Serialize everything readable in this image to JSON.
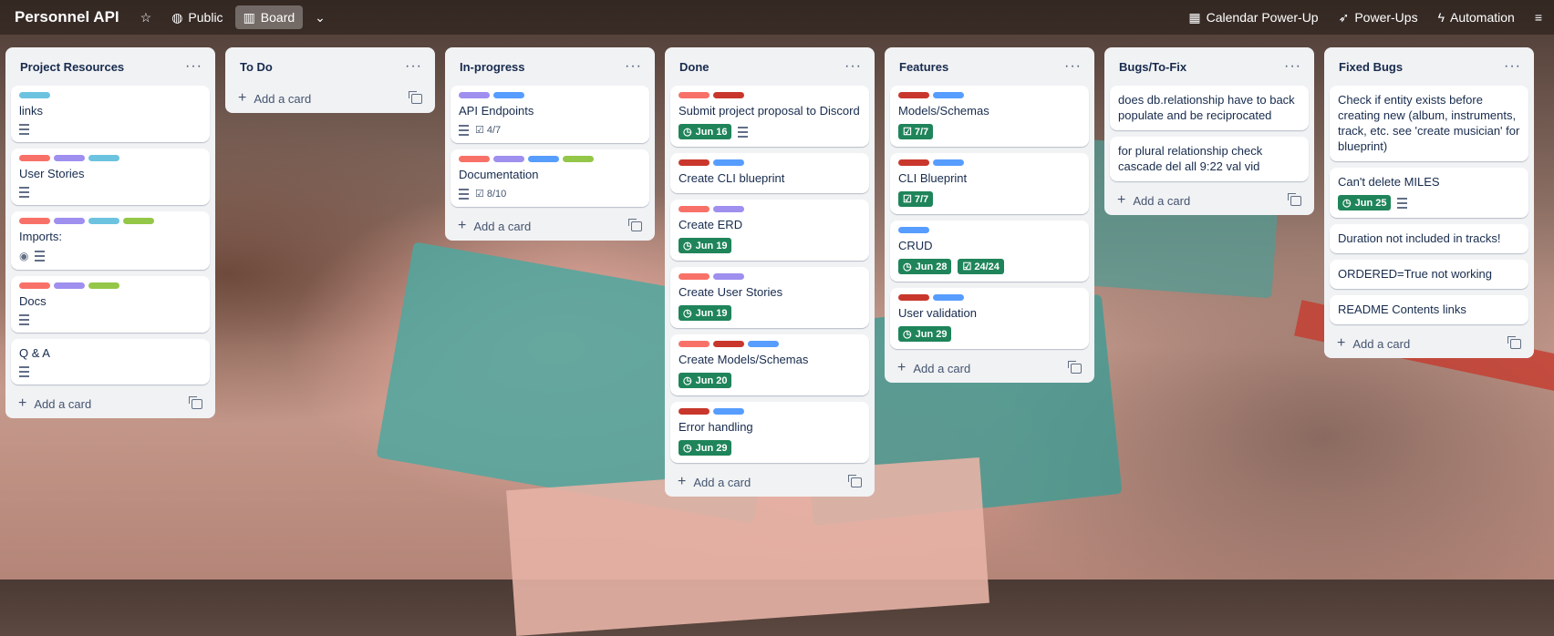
{
  "colors": {
    "red": "#f87168",
    "darkred": "#c9372c",
    "purple": "#9f8fef",
    "teal": "#4bce97",
    "cyan": "#6cc3e0",
    "blue": "#579dff",
    "green": "#94c748"
  },
  "header": {
    "title": "Personnel API",
    "visibility": "Public",
    "view": "Board",
    "calendar": "Calendar Power-Up",
    "powerups": "Power-Ups",
    "automation": "Automation"
  },
  "add_card_label": "Add a card",
  "lists": [
    {
      "title": "Project Resources",
      "cards": [
        {
          "labels": [
            "cyan"
          ],
          "title": "links",
          "desc": true
        },
        {
          "labels": [
            "red",
            "purple",
            "cyan"
          ],
          "title": "User Stories",
          "desc": true
        },
        {
          "labels": [
            "red",
            "purple",
            "cyan",
            "green"
          ],
          "title": "Imports:",
          "watch": true,
          "desc": true
        },
        {
          "labels": [
            "red",
            "purple",
            "green"
          ],
          "title": "Docs",
          "desc": true
        },
        {
          "labels": [],
          "title": "Q & A",
          "desc": true
        }
      ]
    },
    {
      "title": "To Do",
      "cards": []
    },
    {
      "title": "In-progress",
      "cards": [
        {
          "labels": [
            "purple",
            "blue"
          ],
          "title": "API Endpoints",
          "desc": true,
          "checklist": "4/7"
        },
        {
          "labels": [
            "red",
            "purple",
            "blue",
            "green"
          ],
          "title": "Documentation",
          "desc": true,
          "checklist": "8/10"
        }
      ]
    },
    {
      "title": "Done",
      "cards": [
        {
          "labels": [
            "red",
            "darkred"
          ],
          "title": "Submit project proposal to Discord",
          "due": "Jun 16",
          "desc": true
        },
        {
          "labels": [
            "darkred",
            "blue"
          ],
          "title": "Create CLI blueprint"
        },
        {
          "labels": [
            "red",
            "purple"
          ],
          "title": "Create ERD",
          "due": "Jun 19"
        },
        {
          "labels": [
            "red",
            "purple"
          ],
          "title": "Create User Stories",
          "due": "Jun 19"
        },
        {
          "labels": [
            "red",
            "darkred",
            "blue"
          ],
          "title": "Create Models/Schemas",
          "due": "Jun 20"
        },
        {
          "labels": [
            "darkred",
            "blue"
          ],
          "title": "Error handling",
          "due": "Jun 29"
        }
      ]
    },
    {
      "title": "Features",
      "cards": [
        {
          "labels": [
            "darkred",
            "blue"
          ],
          "title": "Models/Schemas",
          "checklist_done": "7/7"
        },
        {
          "labels": [
            "darkred",
            "blue"
          ],
          "title": "CLI Blueprint",
          "checklist_done": "7/7"
        },
        {
          "labels": [
            "blue"
          ],
          "title": "CRUD",
          "due": "Jun 28",
          "checklist_done": "24/24"
        },
        {
          "labels": [
            "darkred",
            "blue"
          ],
          "title": "User validation",
          "due": "Jun 29"
        }
      ]
    },
    {
      "title": "Bugs/To-Fix",
      "cards": [
        {
          "labels": [],
          "title": "does db.relationship have to back populate and be reciprocated"
        },
        {
          "labels": [],
          "title": "for plural relationship check cascade del all 9:22 val vid"
        }
      ]
    },
    {
      "title": "Fixed Bugs",
      "cards": [
        {
          "labels": [],
          "title": "Check if entity exists before creating new (album, instruments, track, etc. see 'create musician' for blueprint)"
        },
        {
          "labels": [],
          "title": "Can't delete MILES",
          "due": "Jun 25",
          "desc": true
        },
        {
          "labels": [],
          "title": "Duration not included in tracks!"
        },
        {
          "labels": [],
          "title": "ORDERED=True not working"
        },
        {
          "labels": [],
          "title": "README Contents links"
        }
      ]
    }
  ]
}
